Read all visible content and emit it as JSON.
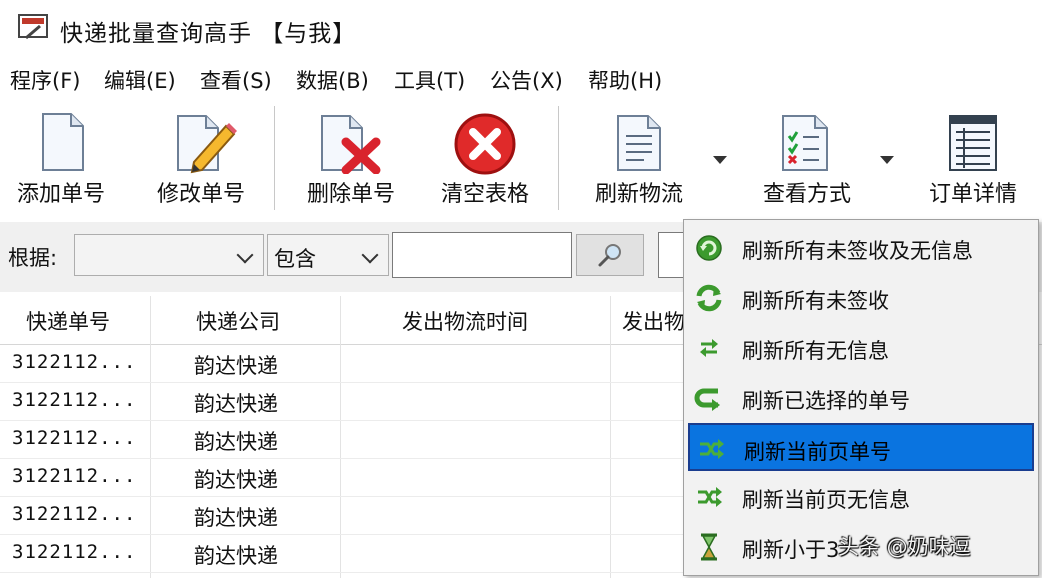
{
  "window": {
    "title": "快递批量查询高手 【与我】"
  },
  "menu": [
    "程序(F)",
    "编辑(E)",
    "查看(S)",
    "数据(B)",
    "工具(T)",
    "公告(X)",
    "帮助(H)"
  ],
  "toolbar": {
    "add": "添加单号",
    "edit": "修改单号",
    "delete": "删除单号",
    "clear": "清空表格",
    "refresh": "刷新物流",
    "view": "查看方式",
    "detail": "订单详情"
  },
  "filter": {
    "label": "根据:",
    "field_value": "",
    "match_value": "包含",
    "query_value": ""
  },
  "grid": {
    "columns": [
      "快递单号",
      "快递公司",
      "发出物流时间",
      "发出物"
    ],
    "rows": [
      {
        "number": "3122112...",
        "company": "韵达快递"
      },
      {
        "number": "3122112...",
        "company": "韵达快递"
      },
      {
        "number": "3122112...",
        "company": "韵达快递"
      },
      {
        "number": "3122112...",
        "company": "韵达快递"
      },
      {
        "number": "3122112...",
        "company": "韵达快递"
      },
      {
        "number": "3122112...",
        "company": "韵达快递"
      }
    ]
  },
  "refresh_menu": {
    "items": [
      {
        "label": "刷新所有未签收及无信息",
        "icon": "refresh-all-icon"
      },
      {
        "label": "刷新所有未签收",
        "icon": "refresh-unsigned-icon"
      },
      {
        "label": "刷新所有无信息",
        "icon": "refresh-noinfo-icon"
      },
      {
        "label": "刷新已选择的单号",
        "icon": "refresh-selected-icon"
      },
      {
        "label": "刷新当前页单号",
        "icon": "refresh-page-icon",
        "highlighted": true
      },
      {
        "label": "刷新当前页无信息",
        "icon": "refresh-page-noinfo-icon"
      },
      {
        "label": "刷新小于3",
        "icon": "hourglass-icon"
      }
    ]
  },
  "watermark": "头条 @奶味逗",
  "colors": {
    "highlight": "#0a74e0",
    "highlight_border": "#1a3d8f",
    "filterbar": "#f0f0f0"
  }
}
